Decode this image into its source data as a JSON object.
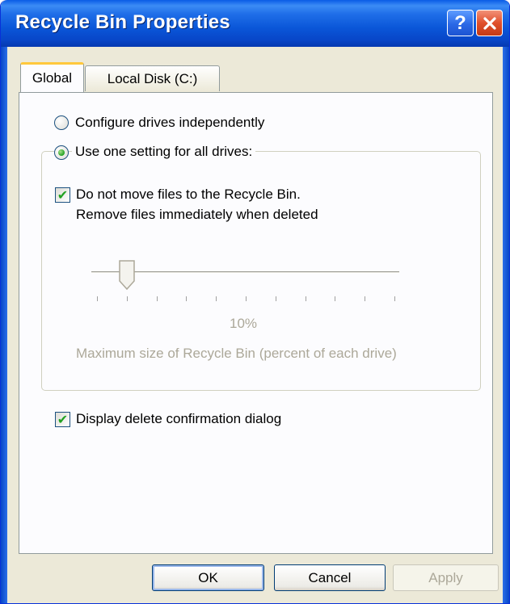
{
  "window": {
    "title": "Recycle Bin Properties",
    "help_label": "?"
  },
  "tabs": [
    {
      "label": "Global",
      "selected": true
    },
    {
      "label": "Local Disk (C:)",
      "selected": false
    }
  ],
  "options": {
    "configure_independently": {
      "label": "Configure drives independently",
      "selected": false
    },
    "one_setting": {
      "label": "Use one setting for all drives:",
      "selected": true
    },
    "do_not_move": {
      "line1": "Do not move files to the Recycle Bin.",
      "line2": "Remove files immediately when deleted",
      "checked": true
    },
    "slider": {
      "value": 0.1,
      "value_label": "10%",
      "caption": "Maximum size of Recycle Bin (percent of each drive)",
      "enabled": false
    },
    "display_confirmation": {
      "label": "Display delete confirmation dialog",
      "checked": true
    }
  },
  "buttons": {
    "ok": "OK",
    "cancel": "Cancel",
    "apply": "Apply"
  },
  "colors": {
    "title_bar": "#0a56d8",
    "window_face": "#ece9d8",
    "check_green": "#21a121",
    "selected_tab_accent": "#ffc83c"
  }
}
